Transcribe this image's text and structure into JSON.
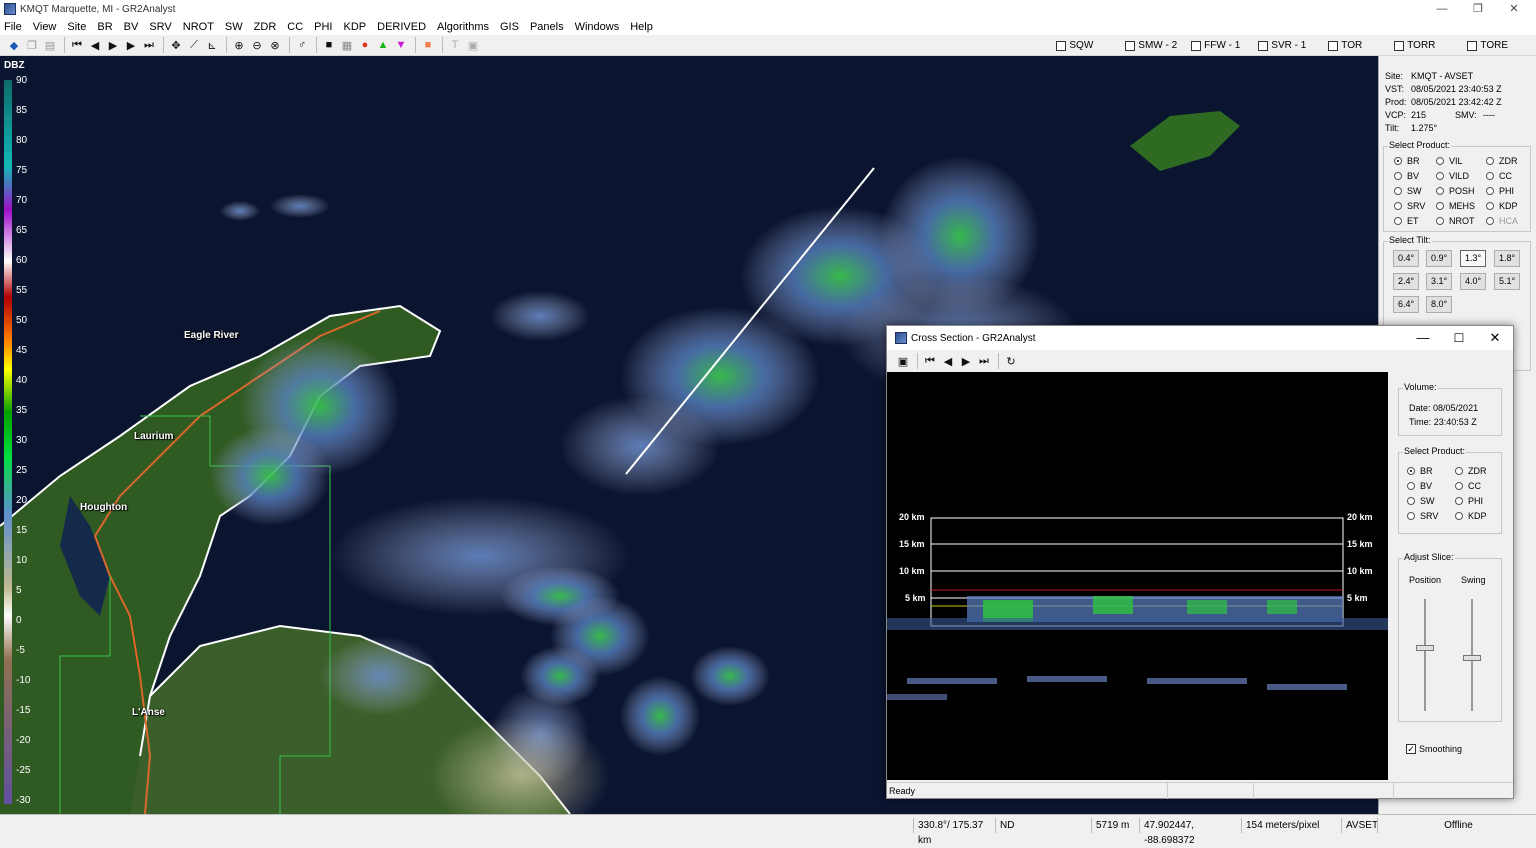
{
  "window": {
    "title": "KMQT Marquette, MI - GR2Analyst",
    "min": "—",
    "max": "❐",
    "close": "✕"
  },
  "menu": [
    "File",
    "View",
    "Site",
    "BR",
    "BV",
    "SRV",
    "NROT",
    "SW",
    "ZDR",
    "CC",
    "PHI",
    "KDP",
    "DERIVED",
    "Algorithms",
    "GIS",
    "Panels",
    "Windows",
    "Help"
  ],
  "warnings": [
    {
      "label": "SQW"
    },
    {
      "label": "SMW - 2"
    },
    {
      "label": "FFW - 1"
    },
    {
      "label": "SVR - 1"
    },
    {
      "label": "TOR"
    },
    {
      "label": "TORR"
    },
    {
      "label": "TORE"
    }
  ],
  "legend": {
    "unit": "DBZ",
    "ticks": [
      "90",
      "85",
      "80",
      "75",
      "70",
      "65",
      "60",
      "55",
      "50",
      "45",
      "40",
      "35",
      "30",
      "25",
      "20",
      "15",
      "10",
      "5",
      "0",
      "-5",
      "-10",
      "-15",
      "-20",
      "-25",
      "-30"
    ]
  },
  "cities": [
    "Eagle River",
    "Laurium",
    "Houghton",
    "L'Anse"
  ],
  "info": {
    "site_lbl": "Site:",
    "site": "KMQT - AVSET",
    "vst_lbl": "VST:",
    "vst": "08/05/2021  23:40:53 Z",
    "prod_lbl": "Prod:",
    "prod": "08/05/2021  23:42:42 Z",
    "vcp_lbl": "VCP:",
    "vcp": "215",
    "smv_lbl": "SMV:",
    "smv": "----",
    "tilt_lbl": "Tilt:",
    "tilt": "1.275°"
  },
  "select_product": {
    "title": "Select Product:",
    "items": [
      {
        "label": "BR",
        "on": true
      },
      {
        "label": "VIL"
      },
      {
        "label": "ZDR"
      },
      {
        "label": "BV"
      },
      {
        "label": "VILD"
      },
      {
        "label": "CC"
      },
      {
        "label": "SW"
      },
      {
        "label": "POSH"
      },
      {
        "label": "PHI"
      },
      {
        "label": "SRV"
      },
      {
        "label": "MEHS"
      },
      {
        "label": "KDP"
      },
      {
        "label": "ET"
      },
      {
        "label": "NROT"
      },
      {
        "label": "HCA"
      }
    ]
  },
  "select_tilt": {
    "title": "Select Tilt:",
    "tilts": [
      "0.4°",
      "0.9°",
      "1.3°",
      "1.8°",
      "2.4°",
      "3.1°",
      "4.0°",
      "5.1°",
      "6.4°",
      "8.0°"
    ],
    "selected": "1.3°"
  },
  "cross_section": {
    "title": "Cross Section - GR2Analyst",
    "volume_title": "Volume:",
    "date_lbl": "Date:",
    "date": "08/05/2021",
    "time_lbl": "Time:",
    "time": "23:40:53 Z",
    "product_title": "Select Product:",
    "products": [
      {
        "label": "BR",
        "on": true
      },
      {
        "label": "ZDR"
      },
      {
        "label": "BV"
      },
      {
        "label": "CC"
      },
      {
        "label": "SW"
      },
      {
        "label": "PHI"
      },
      {
        "label": "SRV"
      },
      {
        "label": "KDP"
      }
    ],
    "heights": [
      "20 km",
      "15 km",
      "10 km",
      "5 km"
    ],
    "adjust_title": "Adjust Slice:",
    "position_lbl": "Position",
    "swing_lbl": "Swing",
    "smoothing_lbl": "Smoothing",
    "status": "Ready"
  },
  "status": {
    "azimuth": "330.8°/ 175.37 km",
    "nd": "ND",
    "height": "5719 m",
    "latlon": "47.902447, -88.698372",
    "scale": "154 meters/pixel",
    "site": "AVSET",
    "mode": "Offline"
  },
  "colors": {
    "land": "#2f5a22",
    "water": "#0b1530",
    "accent": "#0078d7"
  }
}
